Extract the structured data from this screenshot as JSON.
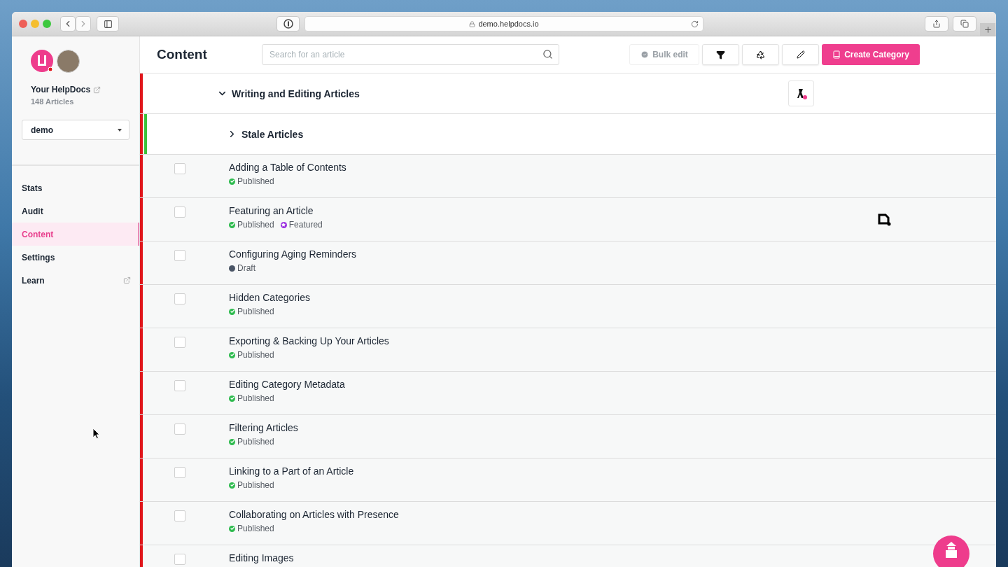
{
  "browser": {
    "address": "demo.helpdocs.io"
  },
  "sidebar": {
    "site_name": "Your HelpDocs",
    "article_count": "148 Articles",
    "workspace": "demo",
    "items": [
      {
        "label": "Stats",
        "selected": false,
        "external": false
      },
      {
        "label": "Audit",
        "selected": false,
        "external": false
      },
      {
        "label": "Content",
        "selected": true,
        "external": false
      },
      {
        "label": "Settings",
        "selected": false,
        "external": false
      },
      {
        "label": "Learn",
        "selected": false,
        "external": true
      }
    ]
  },
  "header": {
    "title": "Content",
    "search": {
      "placeholder": "Search for an article"
    },
    "buttons": [
      {
        "kind": "bulk",
        "label": "Bulk edit",
        "disabled": true
      },
      {
        "kind": "filter",
        "disabled": false
      },
      {
        "kind": "recycle",
        "disabled": false
      },
      {
        "kind": "edit",
        "disabled": false
      },
      {
        "kind": "create",
        "label": "Create Category",
        "disabled": false
      }
    ]
  },
  "category": {
    "title": "Writing and Editing Articles",
    "expanded": true,
    "color": "#e0161b",
    "subcategory": {
      "title": "Stale Articles",
      "expanded": false,
      "color": "#3cc23c"
    },
    "articles": [
      {
        "title": "Adding a Table of Contents",
        "checked": false,
        "statuses": [
          {
            "kind": "published",
            "label": "Published",
            "color": "#2fbb4f"
          }
        ]
      },
      {
        "title": "Featuring an Article",
        "checked": false,
        "statuses": [
          {
            "kind": "published",
            "label": "Published",
            "color": "#2fbb4f"
          },
          {
            "kind": "featured",
            "label": "Featured",
            "color": "#9b30e0"
          }
        ]
      },
      {
        "title": "Configuring Aging Reminders",
        "checked": false,
        "statuses": [
          {
            "kind": "draft",
            "label": "Draft",
            "color": "#4a5566"
          }
        ]
      },
      {
        "title": "Hidden Categories",
        "checked": false,
        "statuses": [
          {
            "kind": "published",
            "label": "Published",
            "color": "#2fbb4f"
          }
        ]
      },
      {
        "title": "Exporting & Backing Up Your Articles",
        "checked": false,
        "statuses": [
          {
            "kind": "published",
            "label": "Published",
            "color": "#2fbb4f"
          }
        ]
      },
      {
        "title": "Editing Category Metadata",
        "checked": false,
        "statuses": [
          {
            "kind": "published",
            "label": "Published",
            "color": "#2fbb4f"
          }
        ]
      },
      {
        "title": "Filtering Articles",
        "checked": false,
        "statuses": [
          {
            "kind": "published",
            "label": "Published",
            "color": "#2fbb4f"
          }
        ]
      },
      {
        "title": "Linking to a Part of an Article",
        "checked": false,
        "statuses": [
          {
            "kind": "published",
            "label": "Published",
            "color": "#2fbb4f"
          }
        ]
      },
      {
        "title": "Collaborating on Articles with Presence",
        "checked": false,
        "statuses": [
          {
            "kind": "published",
            "label": "Published",
            "color": "#2fbb4f"
          }
        ]
      },
      {
        "title": "Editing Images",
        "checked": false
      }
    ]
  }
}
